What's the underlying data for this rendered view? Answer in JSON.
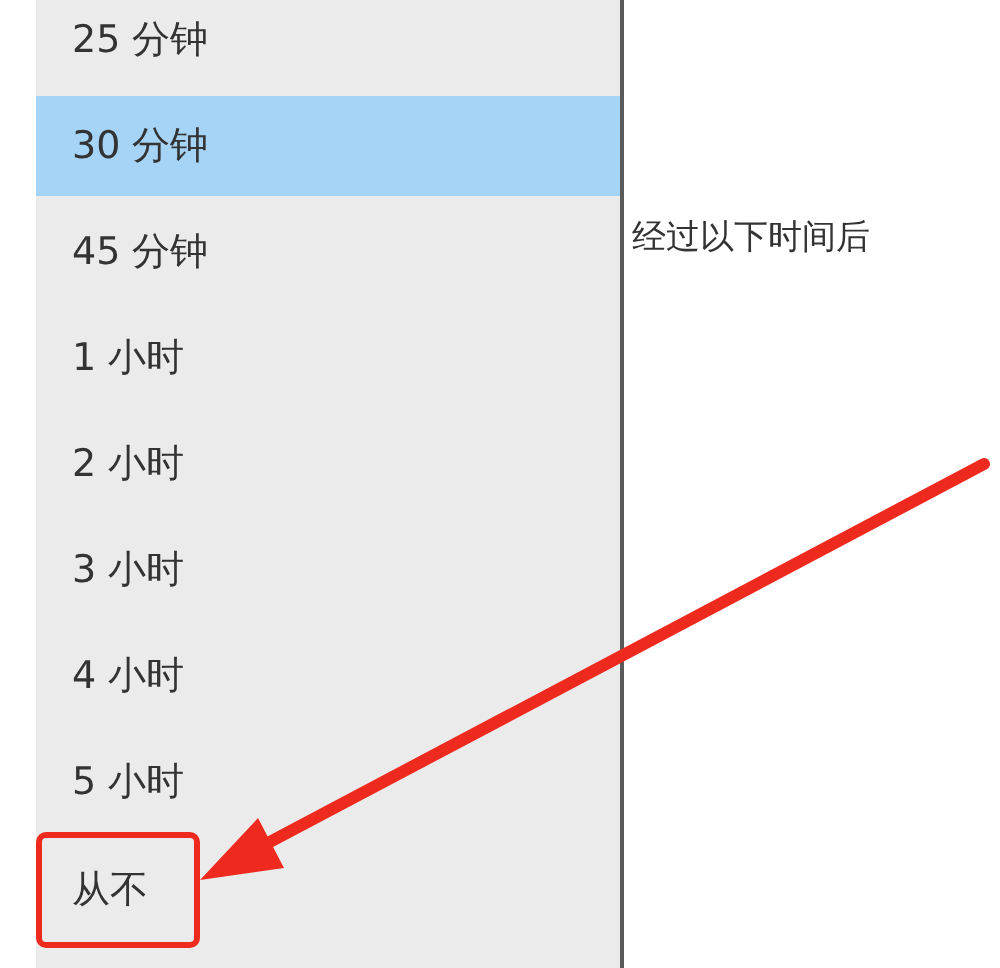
{
  "dropdown": {
    "items": [
      {
        "label": "25 分钟",
        "selected": false,
        "annotated": false
      },
      {
        "label": "30 分钟",
        "selected": true,
        "annotated": false
      },
      {
        "label": "45 分钟",
        "selected": false,
        "annotated": false
      },
      {
        "label": "1 小时",
        "selected": false,
        "annotated": false
      },
      {
        "label": "2 小时",
        "selected": false,
        "annotated": false
      },
      {
        "label": "3 小时",
        "selected": false,
        "annotated": false
      },
      {
        "label": "4 小时",
        "selected": false,
        "annotated": false
      },
      {
        "label": "5 小时",
        "selected": false,
        "annotated": false
      },
      {
        "label": "从不",
        "selected": false,
        "annotated": true
      }
    ]
  },
  "setting_label": "经过以下时间后"
}
